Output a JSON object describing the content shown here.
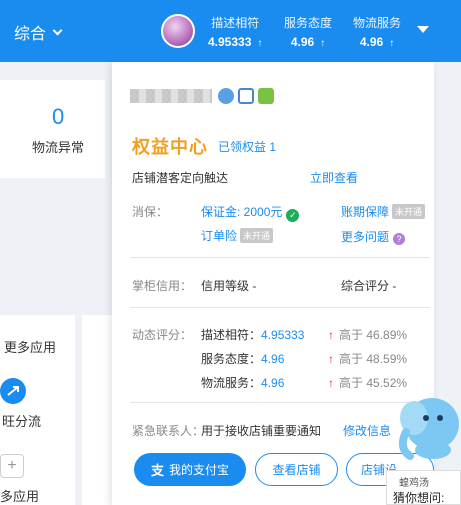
{
  "header": {
    "title": "综合",
    "metrics": [
      {
        "label": "描述相符",
        "value": "4.95333",
        "arrow": "↑"
      },
      {
        "label": "服务态度",
        "value": "4.96",
        "arrow": "↑"
      },
      {
        "label": "物流服务",
        "value": "4.96",
        "arrow": "↑"
      }
    ]
  },
  "background": {
    "count": "0",
    "count_label": "物流异常",
    "more_apps": "更多应用",
    "wangwang": "旺分流",
    "more_apps_2": "多应用",
    "plus": "+"
  },
  "panel": {
    "benefit_title": "权益中心",
    "benefit_count": "已领权益 1",
    "reach_text": "店铺潜客定向触达",
    "reach_link": "立即查看",
    "guarantee": {
      "label": "消保：",
      "deposit": "保证金: 2000元",
      "deposit_ok": "✓",
      "period": "账期保障",
      "order_insurance": "订单险",
      "not_enabled": "未开通",
      "more_questions": "更多问题",
      "question_mark": "?"
    },
    "credit": {
      "label": "掌柜信用：",
      "level": "信用等级 -",
      "overall": "综合评分 -"
    },
    "dynamic": {
      "label": "动态评分：",
      "rows": [
        {
          "name": "描述相符：",
          "value": "4.95333",
          "arrow": "↑",
          "compare": "高于 46.89%"
        },
        {
          "name": "服务态度：",
          "value": "4.96",
          "arrow": "↑",
          "compare": "高于 48.59%"
        },
        {
          "name": "物流服务：",
          "value": "4.96",
          "arrow": "↑",
          "compare": "高于 45.52%"
        }
      ]
    },
    "contact": {
      "label": "紧急联系人：",
      "text": "用于接收店铺重要通知",
      "link": "修改信息"
    },
    "buttons": {
      "alipay": "我的支付宝",
      "alipay_icon": "支",
      "view_shop": "查看店铺",
      "shop_settings": "店铺设"
    }
  },
  "watermark": {
    "line1": "蝗鸡汤",
    "line2": "猜你想问:"
  },
  "colors": {
    "accent": "#1a8cf0",
    "benefit": "#f0a020",
    "up_red": "#e0302c",
    "ok_green": "#1aad5a"
  }
}
